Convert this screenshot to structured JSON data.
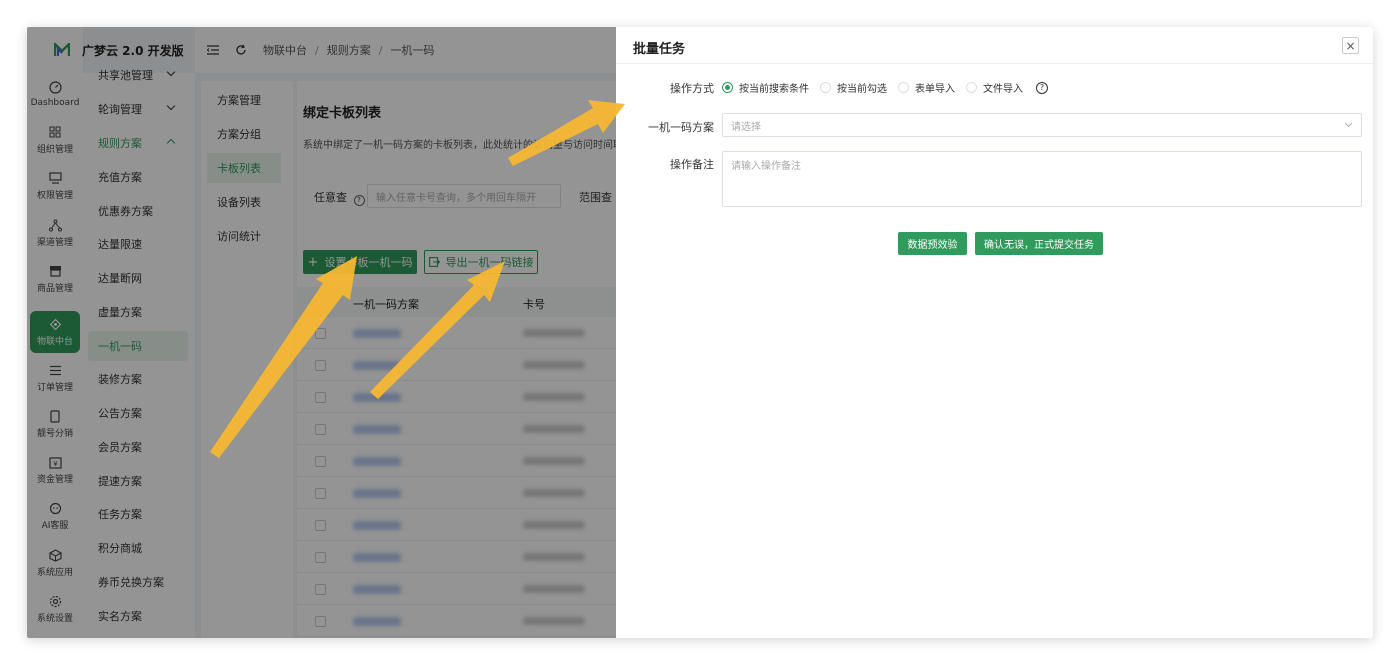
{
  "app": {
    "logo_text": "广梦云 2.0 开发版",
    "brand_color": "#2f9b5c"
  },
  "rail": [
    {
      "label": "Dashboard",
      "icon": "dashboard-icon"
    },
    {
      "label": "组织管理",
      "icon": "grid-icon"
    },
    {
      "label": "权限管理",
      "icon": "monitor-icon"
    },
    {
      "label": "渠道管理",
      "icon": "channel-icon"
    },
    {
      "label": "商品管理",
      "icon": "store-icon"
    },
    {
      "label": "物联中台",
      "icon": "iot-icon"
    },
    {
      "label": "订单管理",
      "icon": "list-icon"
    },
    {
      "label": "靓号分销",
      "icon": "phone-icon"
    },
    {
      "label": "资金管理",
      "icon": "money-icon"
    },
    {
      "label": "AI客服",
      "icon": "ai-icon"
    },
    {
      "label": "系统应用",
      "icon": "box-icon"
    },
    {
      "label": "系统设置",
      "icon": "settings-icon"
    }
  ],
  "subnav": [
    {
      "label": "共享池管理"
    },
    {
      "label": "轮询管理"
    },
    {
      "label": "规则方案"
    },
    {
      "label": "充值方案"
    },
    {
      "label": "优惠券方案"
    },
    {
      "label": "达量限速"
    },
    {
      "label": "达量断网"
    },
    {
      "label": "虚量方案"
    },
    {
      "label": "一机一码"
    },
    {
      "label": "装修方案"
    },
    {
      "label": "公告方案"
    },
    {
      "label": "会员方案"
    },
    {
      "label": "提速方案"
    },
    {
      "label": "任务方案"
    },
    {
      "label": "积分商城"
    },
    {
      "label": "券币兑换方案"
    },
    {
      "label": "实名方案"
    }
  ],
  "breadcrumb": [
    "物联中台",
    "规则方案",
    "一机一码"
  ],
  "innertabs": [
    "方案管理",
    "方案分组",
    "卡板列表",
    "设备列表",
    "访问统计"
  ],
  "main": {
    "title": "绑定卡板列表",
    "description": "系统中绑定了一机一码方案的卡板列表，此处统计的访问量与访问时间取",
    "filter_label": "任意查",
    "filter_placeholder": "输入任意卡号查询，多个用回车隔开",
    "range_label": "范围查",
    "btn_bind": "设置卡板一机一码",
    "btn_export": "导出一机一码链接",
    "columns": [
      "一机一码方案",
      "卡号"
    ],
    "row_count": 10
  },
  "drawer": {
    "title": "批量任务",
    "close": "×",
    "op_label": "操作方式",
    "radios": [
      "按当前搜索条件",
      "按当前勾选",
      "表单导入",
      "文件导入"
    ],
    "help": "?",
    "scheme_label": "一机一码方案",
    "scheme_placeholder": "请选择",
    "remark_label": "操作备注",
    "remark_placeholder": "请输入操作备注",
    "btn_validate": "数据预效验",
    "btn_submit": "确认无误，正式提交任务"
  }
}
